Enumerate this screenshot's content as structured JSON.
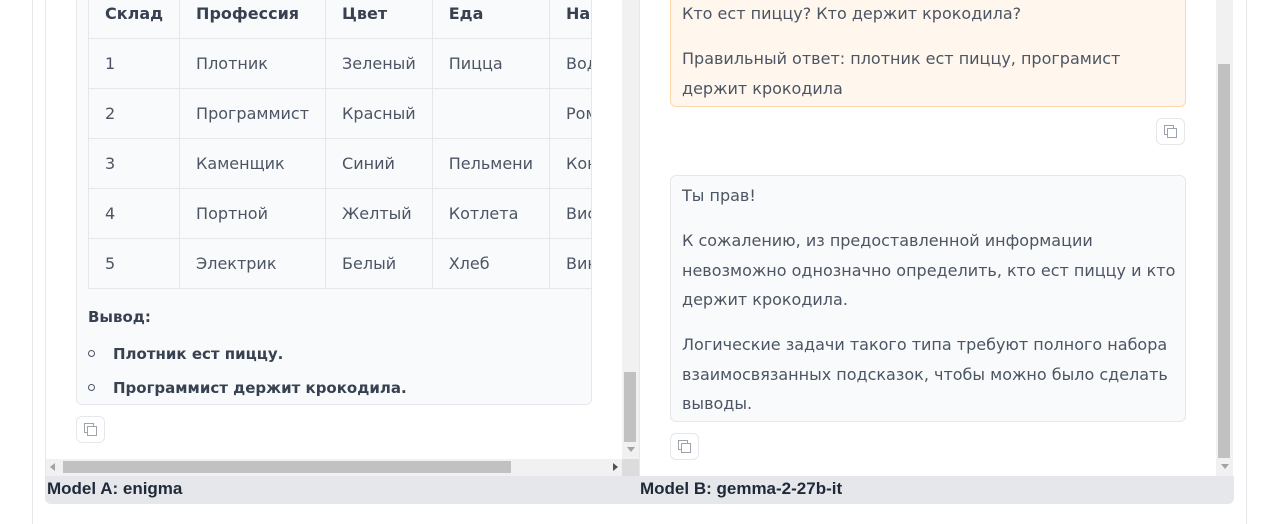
{
  "model_a": {
    "label": "Model A: enigma",
    "table": {
      "headers": [
        "Склад",
        "Профессия",
        "Цвет",
        "Еда",
        "Напиток"
      ],
      "rows": [
        [
          "1",
          "Плотник",
          "Зеленый",
          "Пицца",
          "Водка"
        ],
        [
          "2",
          "Программист",
          "Красный",
          "",
          "Ром"
        ],
        [
          "3",
          "Каменщик",
          "Синий",
          "Пельмени",
          "Коньяк"
        ],
        [
          "4",
          "Портной",
          "Желтый",
          "Котлета",
          "Виски"
        ],
        [
          "5",
          "Электрик",
          "Белый",
          "Хлеб",
          "Вино"
        ]
      ]
    },
    "conclusion_title": "Вывод:",
    "conclusion_items": [
      "Плотник ест пиццу.",
      "Программист держит крокодила."
    ]
  },
  "model_b": {
    "label": "Model B: gemma-2-27b-it",
    "user_message": [
      "Кто ест пиццу? Кто держит крокодила?",
      "Правильный ответ: плотник ест пиццу, програмист держит крокодила"
    ],
    "bot_message": [
      "Ты прав!",
      "К сожалению, из предоставленной информации невозможно однозначно определить, кто ест пиццу и кто держит крокодила.",
      "Логические задачи такого типа требуют полного набора взаимосвязанных подсказок, чтобы можно было сделать выводы."
    ]
  },
  "icons": {
    "copy": "copy-icon"
  }
}
